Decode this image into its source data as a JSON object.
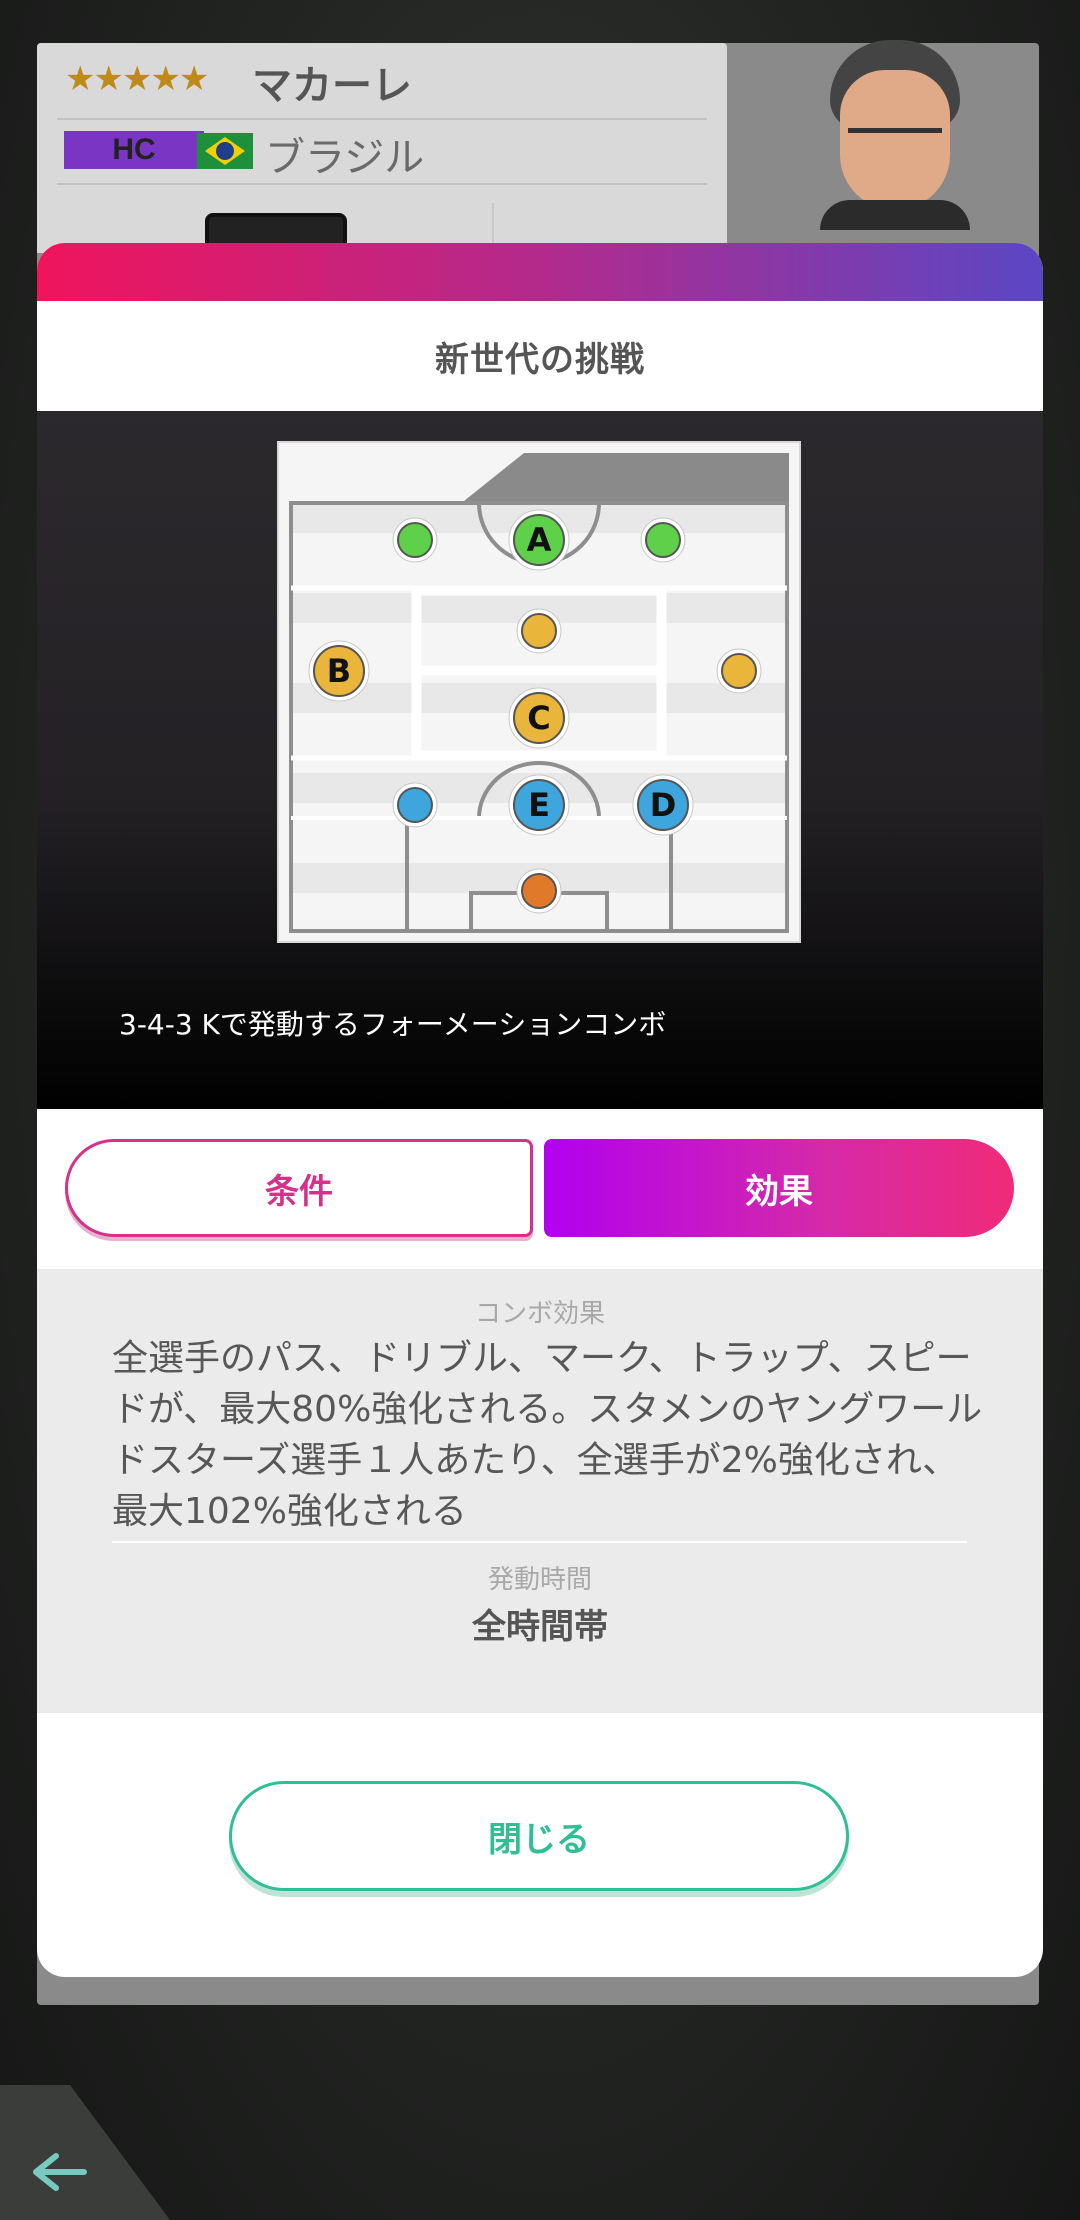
{
  "background_card": {
    "stars": "★★★★★",
    "name": "マカーレ",
    "role_badge": "HC",
    "country": "ブラジル"
  },
  "dialog": {
    "title": "新世代の挑戦",
    "formation_caption": "3-4-3 Kで発動するフォーメーションコンボ",
    "formation_slots": [
      {
        "label": "",
        "color": "#5fd04a"
      },
      {
        "label": "A",
        "color": "#5fd04a"
      },
      {
        "label": "",
        "color": "#5fd04a"
      },
      {
        "label": "",
        "color": "#e9b53a"
      },
      {
        "label": "B",
        "color": "#e9b53a"
      },
      {
        "label": "",
        "color": "#e9b53a"
      },
      {
        "label": "C",
        "color": "#e9b53a"
      },
      {
        "label": "",
        "color": "#3ea6dc"
      },
      {
        "label": "E",
        "color": "#3ea6dc"
      },
      {
        "label": "D",
        "color": "#3ea6dc"
      },
      {
        "label": "",
        "color": "#e07a2a"
      }
    ],
    "tabs": {
      "condition": "条件",
      "effect": "効果"
    },
    "effect": {
      "combo_label": "コンボ効果",
      "combo_text": "全選手のパス、ドリブル、マーク、トラップ、スピードが、最大80%強化される。スタメンのヤングワールドスターズ選手１人あたり、全選手が2%強化され、最大102%強化される",
      "time_label": "発動時間",
      "time_value": "全時間帯"
    },
    "close_label": "閉じる"
  },
  "colors": {
    "header_gradient_start": "#f0145c",
    "header_gradient_end": "#5a47c4",
    "tab_accent": "#d6308a",
    "close_accent": "#2ebf94"
  }
}
